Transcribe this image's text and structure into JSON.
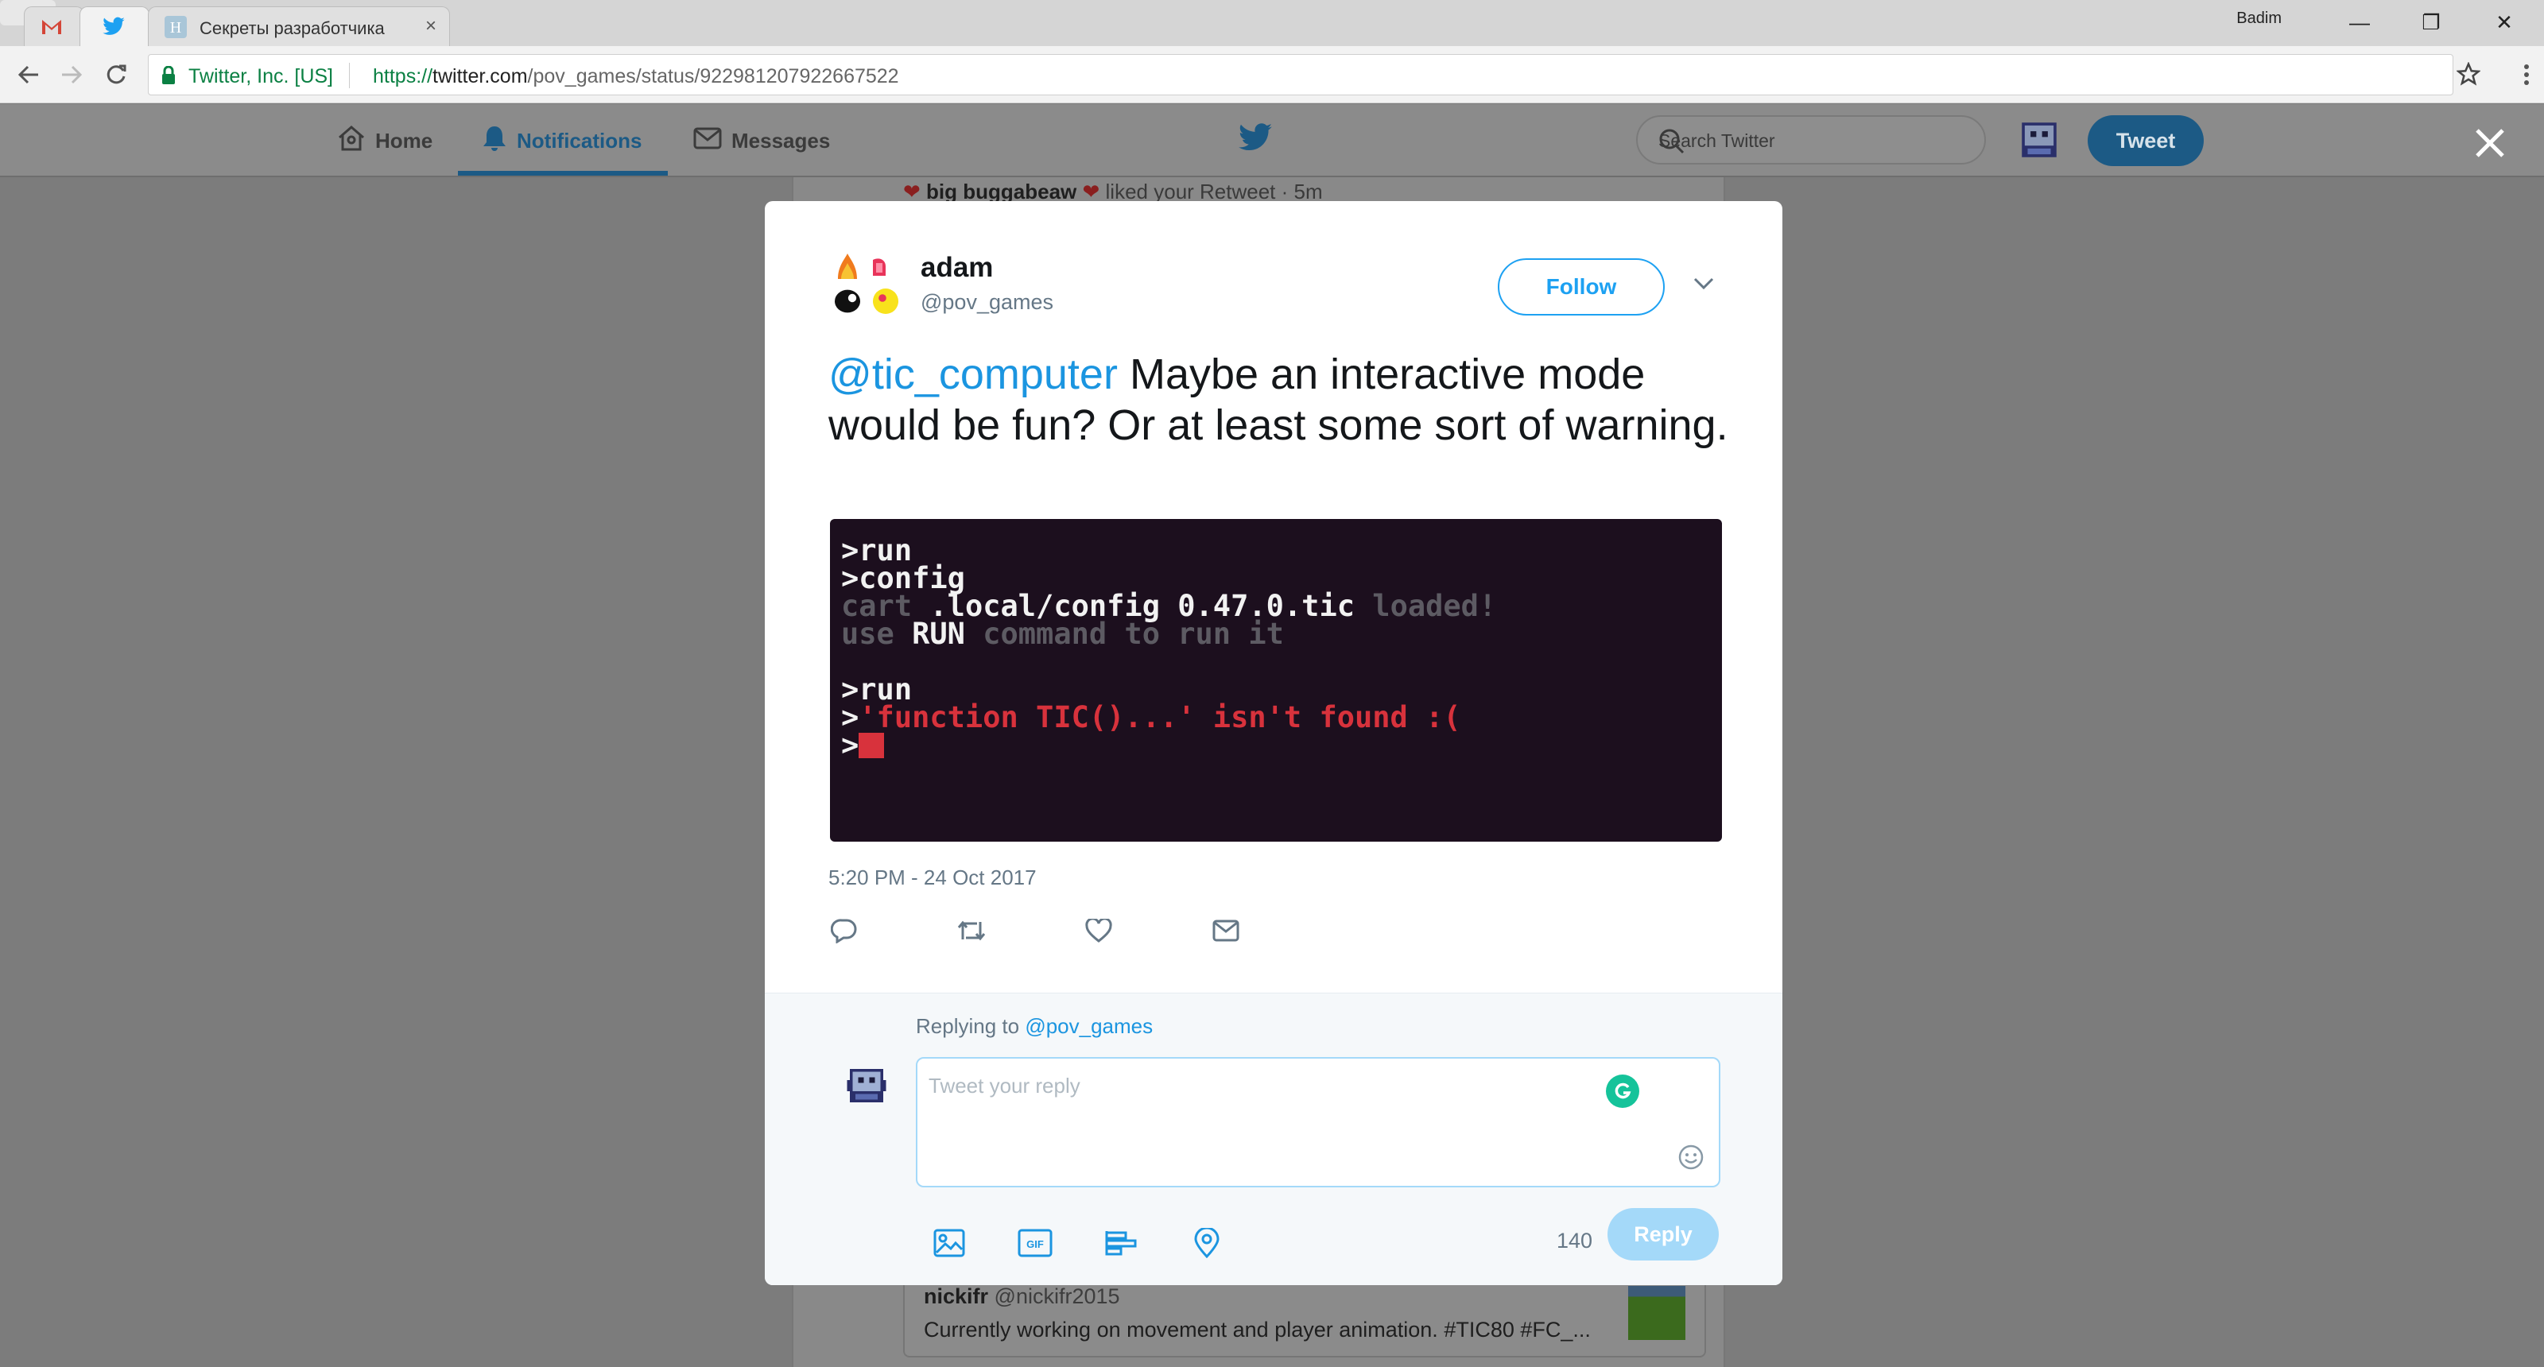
{
  "browser": {
    "tabs": [
      {
        "title": "",
        "icon": "gmail-icon"
      },
      {
        "title": "",
        "icon": "twitter-bird-icon"
      },
      {
        "title": "Секреты разработчика",
        "icon": "habr-icon",
        "close": "×"
      }
    ],
    "user": "Badim",
    "window_controls": {
      "minimize": "—",
      "restore": "❐",
      "close": "✕"
    },
    "address": {
      "secure_label": "Twitter, Inc. [US]",
      "url_scheme": "https://",
      "url_host": "twitter.com",
      "url_path": "/pov_games/status/922981207922667522"
    }
  },
  "twitter_nav": {
    "items": [
      {
        "label": "Home",
        "icon": "home-icon"
      },
      {
        "label": "Notifications",
        "icon": "bell-icon",
        "active": true
      },
      {
        "label": "Messages",
        "icon": "envelope-icon"
      }
    ],
    "search_placeholder": "Search Twitter",
    "tweet_button": "Tweet"
  },
  "background": {
    "notification": {
      "name": "big buggabeaw",
      "action": " liked your Retweet",
      "time": " · 5m"
    },
    "card": {
      "name": "nickifr",
      "handle": "@nickifr2015",
      "text": "Currently working on movement and player animation. #TIC80 #FC_..."
    }
  },
  "tweet": {
    "author_name": "adam",
    "author_handle": "@pov_games",
    "follow_label": "Follow",
    "mention": "@tic_computer",
    "text": " Maybe an interactive mode would be fun? Or at least some sort of warning.",
    "timestamp": "5:20 PM - 24 Oct 2017",
    "terminal_lines": [
      {
        "prompt": ">",
        "text": "run",
        "style": "white"
      },
      {
        "prompt": ">",
        "text": "config",
        "style": "white"
      },
      {
        "segments": [
          {
            "t": "cart ",
            "c": "gray"
          },
          {
            "t": ".local/config 0.47.0.tic",
            "c": "white"
          },
          {
            "t": " loaded!",
            "c": "gray"
          }
        ]
      },
      {
        "segments": [
          {
            "t": "use ",
            "c": "gray"
          },
          {
            "t": "RUN",
            "c": "white"
          },
          {
            "t": " command to run it",
            "c": "gray"
          }
        ]
      },
      {
        "segments": [
          {
            "t": " ",
            "c": "gray"
          }
        ]
      },
      {
        "prompt": ">",
        "text": "run",
        "style": "white"
      },
      {
        "prompt": ">",
        "text": "'function TIC()...' isn't found :(",
        "style": "red"
      },
      {
        "prompt": ">",
        "cursor": true
      }
    ],
    "actions": [
      "reply-icon",
      "retweet-icon",
      "like-icon",
      "direct-message-icon"
    ]
  },
  "reply": {
    "replying_prefix": "Replying to ",
    "replying_to": "@pov_games",
    "placeholder": "Tweet your reply",
    "char_count": "140",
    "reply_button": "Reply",
    "tools": [
      "photo-icon",
      "gif-icon",
      "poll-icon",
      "location-icon"
    ]
  },
  "colors": {
    "accent": "#1da1f2",
    "mention": "#1b95e0",
    "terminal_bg": "#1c0f1e",
    "terminal_red": "#d8323c"
  }
}
